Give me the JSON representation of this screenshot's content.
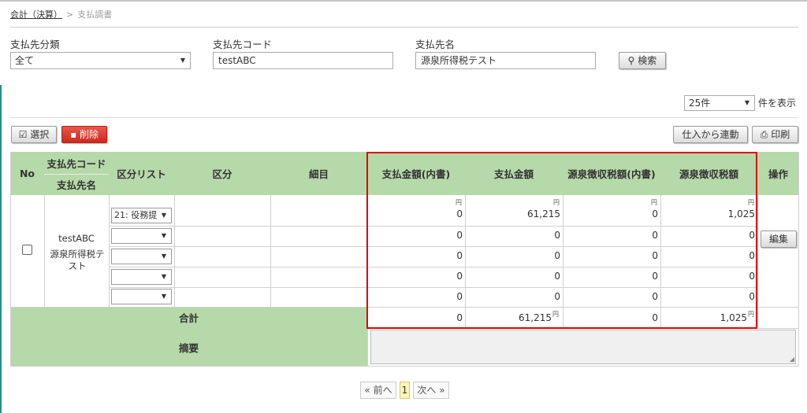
{
  "breadcrumb": {
    "parent": "会計（決算）",
    "separator": ">",
    "current": "支払調書"
  },
  "filters": {
    "category_label": "支払先分類",
    "category_value": "全て",
    "code_label": "支払先コード",
    "code_value": "testABC",
    "name_label": "支払先名",
    "name_value": "源泉所得税テスト",
    "search_button": "検索"
  },
  "per_page": {
    "value": "25件",
    "label": "件を表示"
  },
  "toolbar": {
    "select": "選択",
    "delete": "削除",
    "link_purchase": "仕入から連動",
    "print": "印刷"
  },
  "table": {
    "headers": {
      "no": "No",
      "payee_code": "支払先コード",
      "payee_name": "支払先名",
      "category_list": "区分リスト",
      "category": "区分",
      "detail": "細目",
      "pay_inner": "支払金額(内書)",
      "pay": "支払金額",
      "withholding_inner": "源泉徴収税額(内書)",
      "withholding": "源泉徴収税額",
      "action": "操作"
    },
    "yen": "円",
    "record": {
      "code": "testABC",
      "name": "源泉所得税テスト",
      "edit_button": "編集",
      "rows": [
        {
          "category_option": "21: 役務提",
          "pay_inner": "0",
          "pay": "61,215",
          "withholding_inner": "0",
          "withholding": "1,025"
        },
        {
          "category_option": "",
          "pay_inner": "0",
          "pay": "0",
          "withholding_inner": "0",
          "withholding": "0"
        },
        {
          "category_option": "",
          "pay_inner": "0",
          "pay": "0",
          "withholding_inner": "0",
          "withholding": "0"
        },
        {
          "category_option": "",
          "pay_inner": "0",
          "pay": "0",
          "withholding_inner": "0",
          "withholding": "0"
        },
        {
          "category_option": "",
          "pay_inner": "0",
          "pay": "0",
          "withholding_inner": "0",
          "withholding": "0"
        }
      ]
    },
    "total": {
      "label": "合計",
      "pay_inner": "0",
      "pay": "61,215",
      "withholding_inner": "0",
      "withholding": "1,025"
    },
    "memo_label": "摘要"
  },
  "pagination": {
    "prev": "« 前へ",
    "current": "1",
    "next": "次へ »"
  },
  "colors": {
    "header_green": "#b5d9a8",
    "highlight_red": "#e00000",
    "delete_red": "#d9372b"
  }
}
